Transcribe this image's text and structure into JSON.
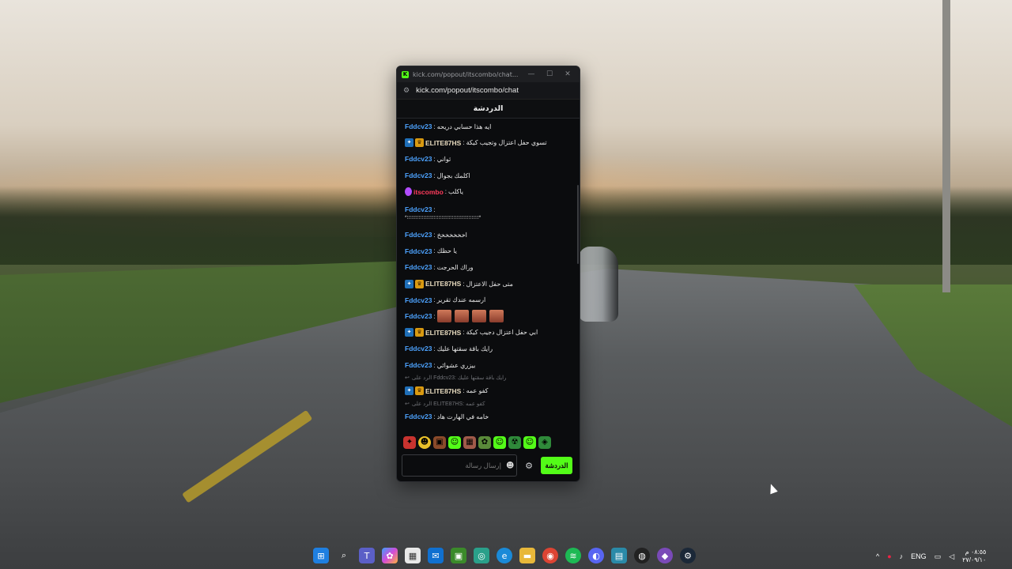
{
  "window": {
    "title": "kick.com/popout/itscombo/chat...",
    "url": "kick.com/popout/itscombo/chat",
    "minimize_glyph": "—",
    "maximize_glyph": "☐",
    "close_glyph": "✕",
    "app_icon": "kick-logo-icon",
    "logo_letter": "K"
  },
  "chat": {
    "header_title": "الدردشة",
    "messages": [
      {
        "user": "Fddcv23",
        "text": "ايه هذا حسابي دريحه"
      },
      {
        "user": "ELITE87HS",
        "text": "تسوي حفل اعتزال وتجيب كيكة"
      },
      {
        "user": "Fddcv23",
        "text": "ثواني"
      },
      {
        "user": "Fddcv23",
        "text": "اكلمك بجوال"
      },
      {
        "user": "itscombo",
        "text": "ياكلب"
      },
      {
        "user": "Fddcv23",
        "text": "*؛؛؛؛؛؛؛؛؛؛؛؛؛؛؛؛؛؛؛؛؛؛؛؛؛؛؛؛؛؛؛؛؛؛؛؛؛؛؛؛؛؛؛؛؛؛؛؛*"
      },
      {
        "user": "Fddcv23",
        "text": "اخخخخخخخ"
      },
      {
        "user": "Fddcv23",
        "text": "يا حظك"
      },
      {
        "user": "Fddcv23",
        "text": "وراك الحرجت"
      },
      {
        "user": "ELITE87HS",
        "text": "متى حفل الاعتزال"
      },
      {
        "user": "Fddcv23",
        "text": "ارسمه عندك تقرير"
      },
      {
        "user": "Fddcv23",
        "text": ""
      },
      {
        "user": "ELITE87HS",
        "text": "ابي حفل اعتزال دجيب كيكة"
      },
      {
        "user": "Fddcv23",
        "text": "رايك باقة سقتها عليك"
      },
      {
        "user": "Fddcv23",
        "text": "بيزري عشوائي"
      },
      {
        "reply_to": "الرد على Fddcv23: رايك باقة سقتها عليك",
        "user": "ELITE87HS",
        "text": "كفو عمه"
      },
      {
        "reply_to": "الرد على ELITE87HS: كفو عمه",
        "user": "Fddcv23",
        "text": "خامه في الهارت هاد"
      }
    ],
    "input_placeholder": "إرسال رسالة",
    "send_label": "الدردشة",
    "accent": "#53fc18",
    "username_blue": "#4da3ff",
    "username_red": "#ff3b5c"
  },
  "taskbar": {
    "apps": [
      "windows-start-icon",
      "search-icon",
      "teams-icon",
      "copilot-icon",
      "store-icon",
      "outlook-icon",
      "minecraft-icon",
      "network-icon",
      "edge-icon",
      "file-explorer-icon",
      "chrome-icon",
      "spotify-icon",
      "discord-icon",
      "app-icon",
      "obs-icon",
      "game-icon",
      "steam-icon"
    ],
    "tray": {
      "language": "ENG",
      "time": "٠٨:٥٥ م",
      "date": "٢٧/٠٩/١٠"
    }
  }
}
